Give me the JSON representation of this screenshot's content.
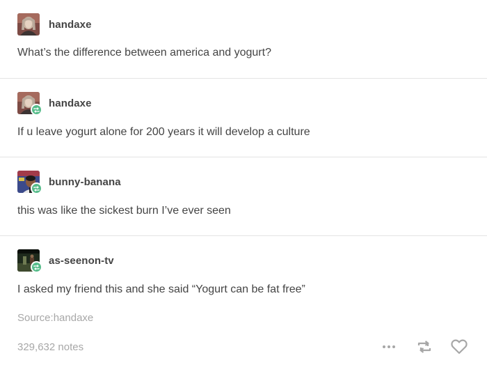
{
  "posts": [
    {
      "username": "handaxe",
      "text": "What’s the difference between america and yogurt?",
      "avatar_icon": "woman-portrait-avatar",
      "reblog": false
    },
    {
      "username": "handaxe",
      "text": "If u leave yogurt alone for 200 years it will develop a culture",
      "avatar_icon": "woman-portrait-avatar",
      "reblog": true
    },
    {
      "username": "bunny-banana",
      "text": "this was like the sickest burn I’ve ever seen",
      "avatar_icon": "man-portrait-avatar",
      "reblog": true
    },
    {
      "username": "as-seenon-tv",
      "text": "I asked my friend this and she said “Yogurt can be fat free”",
      "avatar_icon": "dark-scene-avatar",
      "reblog": true
    }
  ],
  "source": {
    "label": "Source:",
    "name": "handaxe"
  },
  "footer": {
    "notes": "329,632 notes",
    "actions": [
      "more-dots-icon",
      "reblog-icon",
      "heart-icon"
    ]
  },
  "colors": {
    "text": "#444444",
    "muted": "#a7a7a7",
    "reblog_green": "#56bc8a",
    "divider": "#e3e3e3"
  }
}
